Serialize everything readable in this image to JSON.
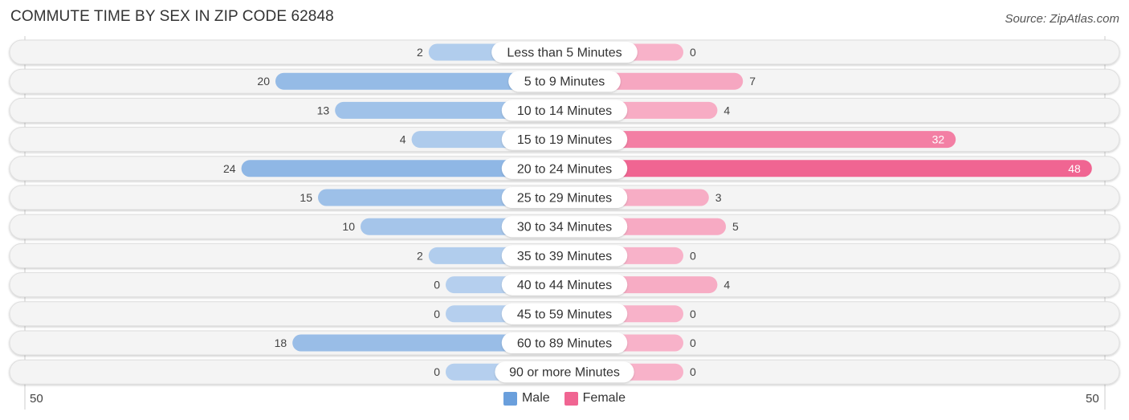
{
  "chart_data": {
    "type": "bar",
    "orientation": "horizontal-diverging",
    "title": "COMMUTE TIME BY SEX IN ZIP CODE 62848",
    "source": "Source: ZipAtlas.com",
    "categories": [
      "Less than 5 Minutes",
      "5 to 9 Minutes",
      "10 to 14 Minutes",
      "15 to 19 Minutes",
      "20 to 24 Minutes",
      "25 to 29 Minutes",
      "30 to 34 Minutes",
      "35 to 39 Minutes",
      "40 to 44 Minutes",
      "45 to 59 Minutes",
      "60 to 89 Minutes",
      "90 or more Minutes"
    ],
    "series": [
      {
        "name": "Male",
        "color": "#6a9fdc",
        "values": [
          2,
          20,
          13,
          4,
          24,
          15,
          10,
          2,
          0,
          0,
          18,
          0
        ]
      },
      {
        "name": "Female",
        "color": "#f06592",
        "values": [
          0,
          7,
          4,
          32,
          48,
          3,
          5,
          0,
          4,
          0,
          0,
          0
        ]
      }
    ],
    "axis": {
      "left_label": "50",
      "right_label": "50",
      "max": 50
    },
    "legend": {
      "position": "bottom-center",
      "items": [
        "Male",
        "Female"
      ]
    }
  }
}
